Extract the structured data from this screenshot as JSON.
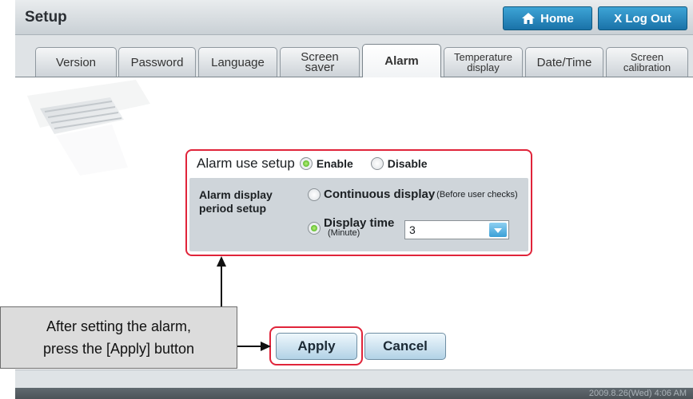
{
  "header": {
    "title": "Setup",
    "home_label": "Home",
    "logout_label": "X Log Out"
  },
  "tabs": [
    {
      "label": "Version",
      "active": false
    },
    {
      "label": "Password",
      "active": false
    },
    {
      "label": "Language",
      "active": false
    },
    {
      "label_line1": "Screen",
      "label_line2": "saver",
      "active": false
    },
    {
      "label": "Alarm",
      "active": true
    },
    {
      "label_line1": "Temperature",
      "label_line2": "display",
      "active": false
    },
    {
      "label": "Date/Time",
      "active": false
    },
    {
      "label_line1": "Screen",
      "label_line2": "calibration",
      "active": false
    }
  ],
  "alarm": {
    "use_setup_label": "Alarm use setup",
    "enable_label": "Enable",
    "disable_label": "Disable",
    "use_value": "Enable",
    "period_label_line1": "Alarm display",
    "period_label_line2": "period setup",
    "continuous_label": "Continuous display",
    "continuous_note": "(Before user checks)",
    "display_time_label": "Display time",
    "display_time_unit": "(Minute)",
    "period_value": "Display time",
    "display_time_value": "3"
  },
  "buttons": {
    "apply_label": "Apply",
    "cancel_label": "Cancel"
  },
  "callout": {
    "line1": "After setting the alarm,",
    "line2": "press the [Apply] button"
  },
  "footer": {
    "datetime": "2009.8.26(Wed) 4:06 AM"
  },
  "colors": {
    "highlight": "#e0243a",
    "header_button": "#1a72a8",
    "radio_selected": "#3aa80f"
  },
  "icons": {
    "home": "house-icon",
    "select_arrow": "chevron-down-icon"
  }
}
